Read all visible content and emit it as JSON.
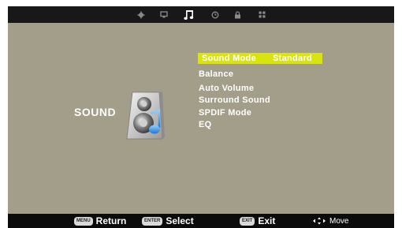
{
  "tabs": [
    {
      "icon": "gear-icon",
      "active": false
    },
    {
      "icon": "picture-icon",
      "active": false
    },
    {
      "icon": "music-note-icon",
      "active": true
    },
    {
      "icon": "clock-icon",
      "active": false
    },
    {
      "icon": "lock-icon",
      "active": false
    },
    {
      "icon": "grid-icon",
      "active": false
    }
  ],
  "section": {
    "title": "SOUND",
    "icon": "speaker-icon"
  },
  "menu": {
    "sound_mode_label": "Sound Mode",
    "sound_mode_value": "Standard",
    "balance": "Balance",
    "auto_volume": "Auto Volume",
    "surround_sound": "Surround Sound",
    "spdif_mode": "SPDIF Mode",
    "eq": "EQ"
  },
  "footer": {
    "menu_key": "MENU",
    "menu_label": "Return",
    "enter_key": "ENTER",
    "enter_label": "Select",
    "exit_key": "EXIT",
    "exit_label": "Exit",
    "move_label": "Move"
  },
  "colors": {
    "panel": "#a39e89",
    "highlight": "#d9e40f",
    "bar": "#0d0d0d"
  }
}
